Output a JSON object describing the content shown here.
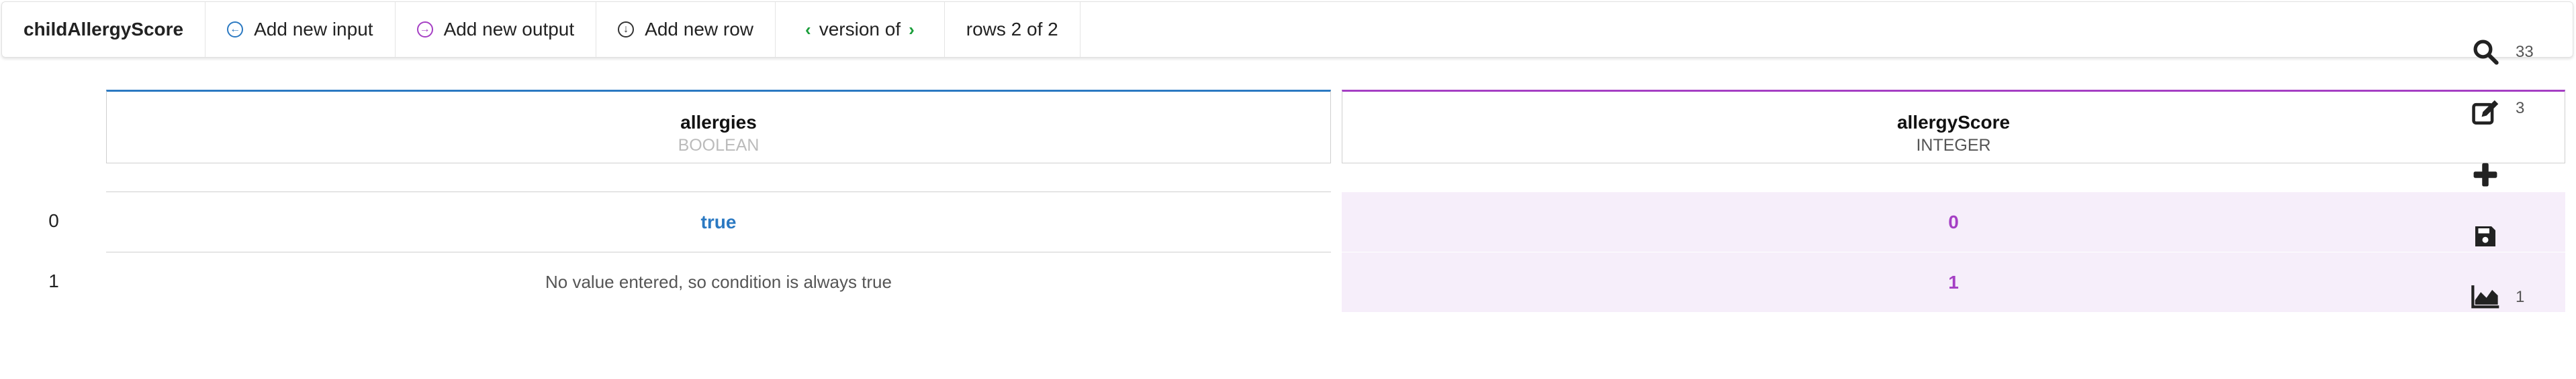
{
  "toolbar": {
    "title": "childAllergyScore",
    "add_input": "Add new input",
    "add_output": "Add new output",
    "add_row": "Add new row",
    "version": "version of",
    "rows": "rows 2 of 2"
  },
  "columns": {
    "input": {
      "name": "allergies",
      "type": "BOOLEAN"
    },
    "output": {
      "name": "allergyScore",
      "type": "INTEGER"
    }
  },
  "rows": [
    {
      "index": "0",
      "input": "true",
      "output": "0"
    },
    {
      "index": "1",
      "input": "No value entered, so condition is always true",
      "output": "1"
    }
  ],
  "side": {
    "search_count": "33",
    "edit_count": "3",
    "chart_count": "1"
  },
  "icons": {
    "search": "search-icon",
    "edit": "edit-icon",
    "add": "plus-icon",
    "save": "save-icon",
    "chart": "area-chart-icon"
  },
  "colors": {
    "input_accent": "#2b79c2",
    "output_accent": "#a53fc4",
    "output_bg": "#f6eefa",
    "version_chevron": "#1a9e3a"
  }
}
